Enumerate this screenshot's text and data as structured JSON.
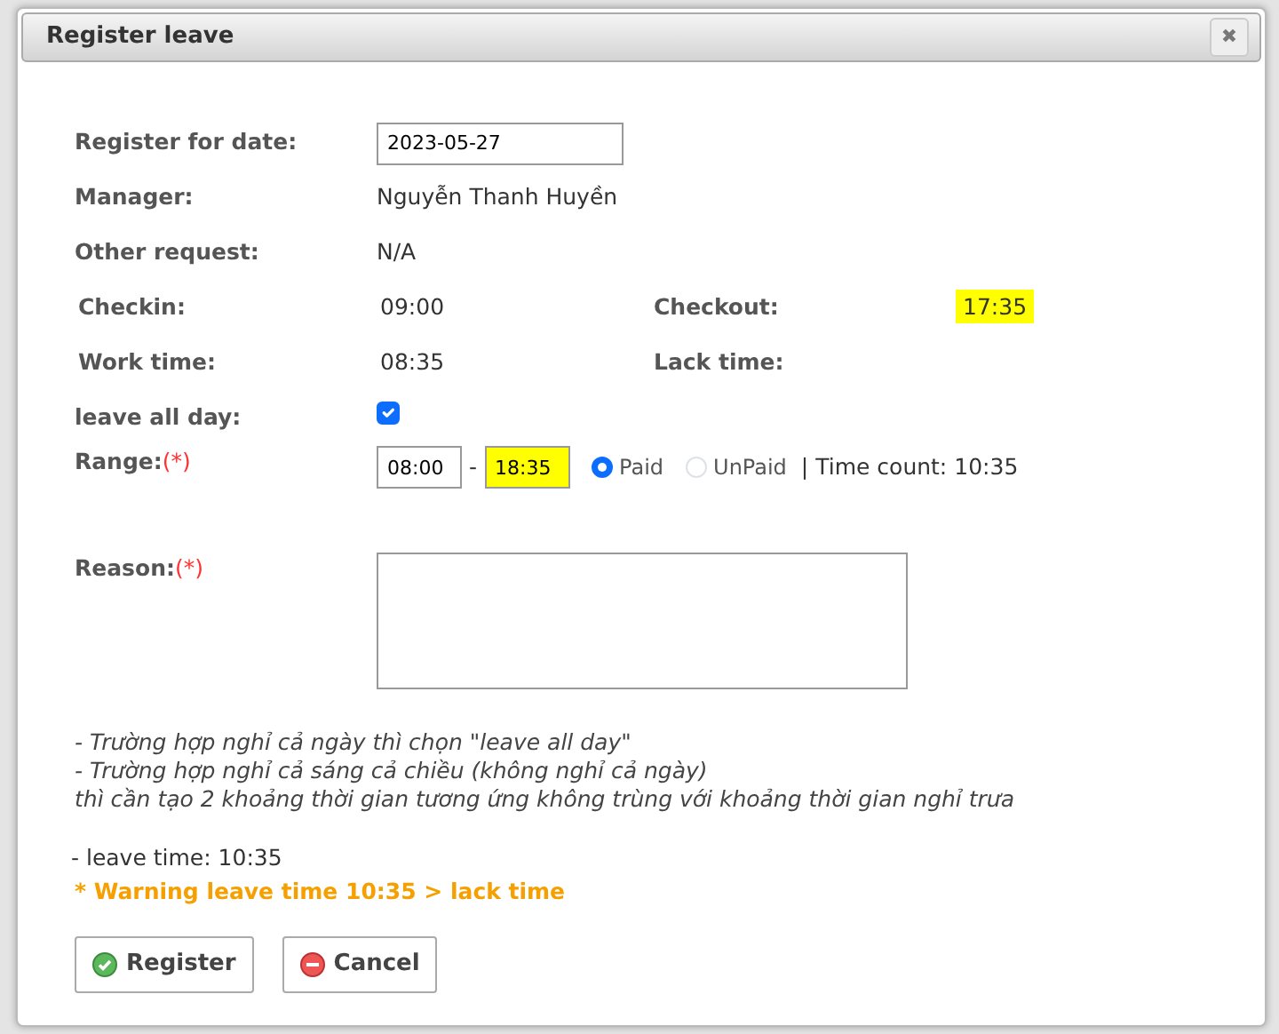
{
  "dialog": {
    "title": "Register leave",
    "close": "✖",
    "date": {
      "label": "Register for date:",
      "value": "2023-05-27"
    },
    "manager": {
      "label": "Manager:",
      "value": "Nguyễn Thanh Huyền"
    },
    "other": {
      "label": "Other request:",
      "value": "N/A"
    },
    "checkin": {
      "label": "Checkin:",
      "value": "09:00"
    },
    "checkout": {
      "label": "Checkout:",
      "value": "17:35",
      "highlighted": true
    },
    "worktime": {
      "label": "Work time:",
      "value": "08:35"
    },
    "lacktime": {
      "label": "Lack time:"
    },
    "allday": {
      "label": "leave all day:",
      "checked": true
    },
    "range": {
      "label": "Range:",
      "required": "(*)",
      "from": {
        "value": "08:00",
        "highlighted": false
      },
      "separator": "-",
      "to": {
        "value": "18:35",
        "highlighted": true
      },
      "options": [
        {
          "label": "Paid",
          "selected": true
        },
        {
          "label": "UnPaid",
          "selected": false
        }
      ],
      "time_count": "| Time count: 10:35"
    },
    "reason": {
      "label": "Reason:",
      "required": "(*)"
    },
    "notes": [
      "- Trường hợp nghỉ cả ngày thì chọn \"leave all day\"",
      "- Trường hợp nghỉ cả sáng cả chiều (không nghỉ cả ngày)",
      "thì cần tạo 2 khoảng thời gian tương ứng không trùng với khoảng thời gian nghỉ trưa"
    ],
    "leave_time": "- leave time: 10:35",
    "warning": "* Warning leave time 10:35 > lack time",
    "buttons": [
      {
        "label": "Register",
        "kind": "ok"
      },
      {
        "label": "Cancel",
        "kind": "cancel"
      }
    ]
  }
}
